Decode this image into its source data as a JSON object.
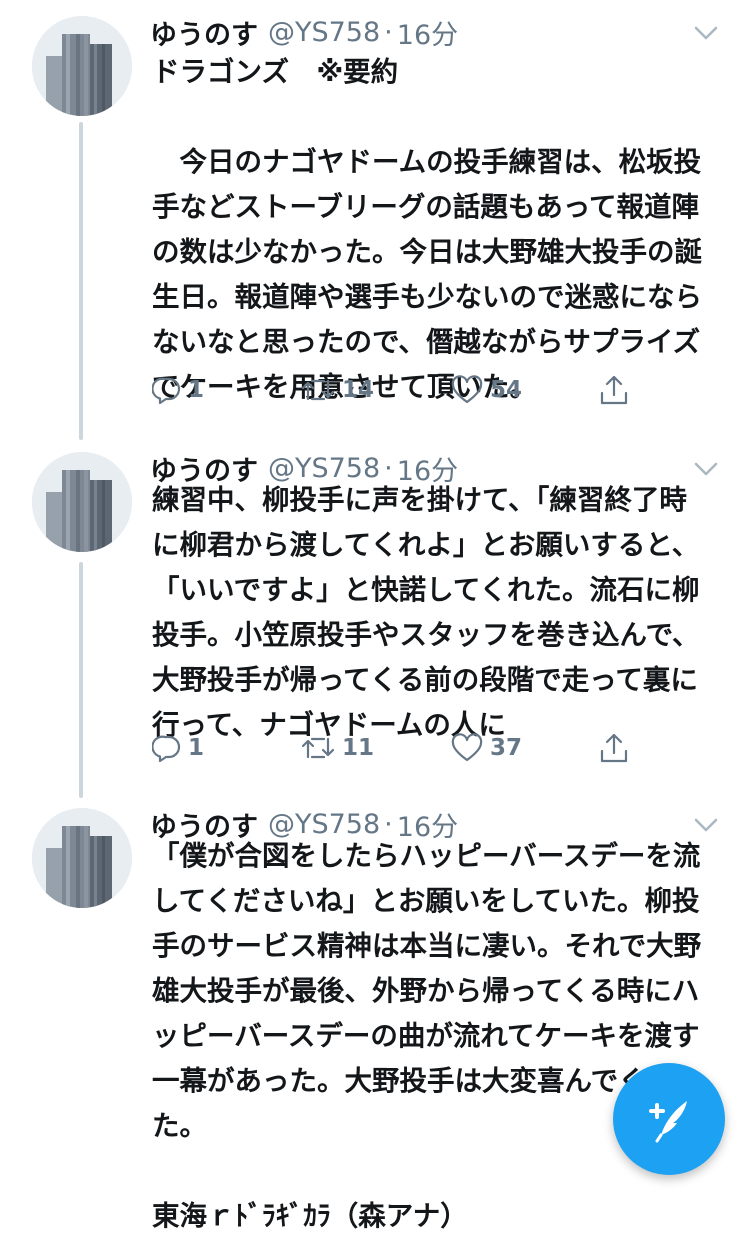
{
  "tweets": [
    {
      "name": "ゆうのす",
      "handle": "@YS758",
      "separator": "·",
      "time": "16分",
      "text": "ドラゴンズ　※要約\n\n　今日のナゴヤドームの投手練習は、松坂投\n手などストーブリーグの話題もあって報道陣\nの数は少なかった。今日は大野雄大投手の誕\n生日。報道陣や選手も少ないので迷惑になら\nないなと思ったので、僭越ながらサプライズ\nでケーキを用意させて頂いた。",
      "reply_count": "1",
      "retweet_count": "14",
      "like_count": "54"
    },
    {
      "name": "ゆうのす",
      "handle": "@YS758",
      "separator": "·",
      "time": "16分",
      "text": "練習中、柳投手に声を掛けて、「練習終了時\nに柳君から渡してくれよ」とお願いすると、\n「いいですよ」と快諾してくれた。流石に柳\n投手。小笠原投手やスタッフを巻き込んで、\n大野投手が帰ってくる前の段階で走って裏に\n行って、ナゴヤドームの人に",
      "reply_count": "1",
      "retweet_count": "11",
      "like_count": "37"
    },
    {
      "name": "ゆうのす",
      "handle": "@YS758",
      "separator": "·",
      "time": "16分",
      "text": "「僕が合図をしたらハッピーバースデーを流\nしてくださいね」とお願いをしていた。柳投\n手のサービス精神は本当に凄い。それで大野\n雄大投手が最後、外野から帰ってくる時にハ\nッピーバースデーの曲が流れてケーキを渡す\n一幕があった。大野投手は大変喜んでくれ\nた。\n\n東海ｒﾄﾞﾗｷﾞｶﾗ（森アナ）"
    }
  ],
  "icons": {
    "reply": "reply-icon",
    "retweet": "retweet-icon",
    "like": "heart-icon",
    "share": "share-icon",
    "more": "chevron-down-icon",
    "compose": "compose-tweet-icon"
  },
  "colors": {
    "text": "#14171a",
    "secondary": "#657786",
    "thread_line": "#ccd6dd",
    "accent": "#1da1f2"
  }
}
